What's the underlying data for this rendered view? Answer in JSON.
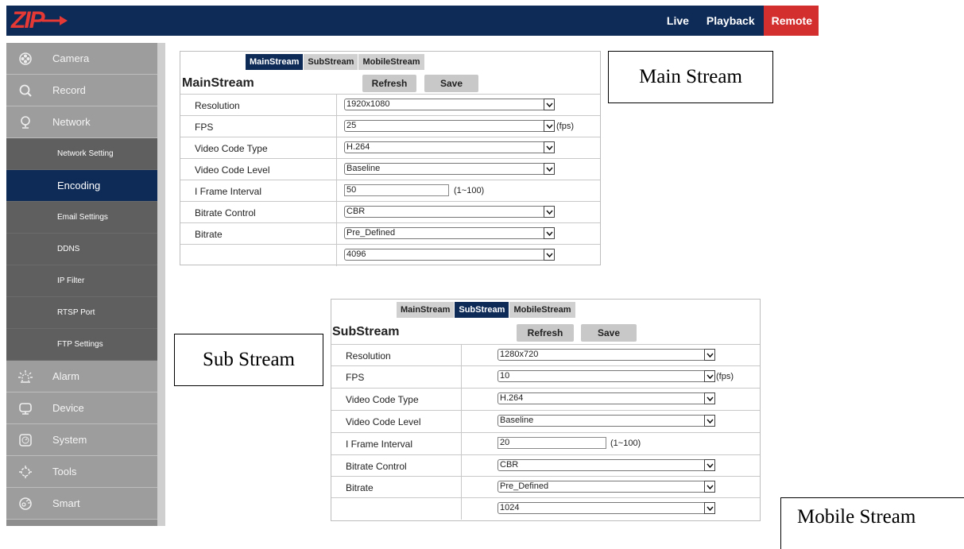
{
  "header": {
    "logo_text": "ZIP",
    "nav": [
      "Live",
      "Playback",
      "Remote"
    ]
  },
  "sidebar": {
    "items": [
      {
        "label": "Camera",
        "icon": "camera-icon"
      },
      {
        "label": "Record",
        "icon": "search-icon"
      },
      {
        "label": "Network",
        "icon": "network-icon"
      }
    ],
    "network_sub": [
      {
        "label": "Network Setting"
      },
      {
        "label": "Encoding"
      },
      {
        "label": "Email Settings"
      },
      {
        "label": "DDNS"
      },
      {
        "label": "IP Filter"
      },
      {
        "label": "RTSP Port"
      },
      {
        "label": "FTP Settings"
      }
    ],
    "items_after": [
      {
        "label": "Alarm",
        "icon": "alarm-icon"
      },
      {
        "label": "Device",
        "icon": "device-icon"
      },
      {
        "label": "System",
        "icon": "system-icon"
      },
      {
        "label": "Tools",
        "icon": "gear-icon"
      },
      {
        "label": "Smart",
        "icon": "smart-icon"
      }
    ]
  },
  "colors": {
    "header_bg": "#0e2b57",
    "active_nav": "#d32f2f",
    "active_tab": "#0e2b57"
  },
  "tabs": [
    "MainStream",
    "SubStream",
    "MobileStream"
  ],
  "buttons": {
    "refresh": "Refresh",
    "save": "Save"
  },
  "main_panel": {
    "title": "MainStream",
    "rows": [
      {
        "label": "Resolution",
        "value": "1920x1080"
      },
      {
        "label": "FPS",
        "value": "25",
        "suffix": "(fps)"
      },
      {
        "label": "Video Code Type",
        "value": "H.264"
      },
      {
        "label": "Video Code Level",
        "value": "Baseline"
      },
      {
        "label": "I Frame Interval",
        "value": "50",
        "suffix": "(1~100)"
      },
      {
        "label": "Bitrate Control",
        "value": "CBR"
      },
      {
        "label": "Bitrate",
        "value": "Pre_Defined"
      },
      {
        "label": "",
        "value": "4096"
      }
    ]
  },
  "sub_panel": {
    "title": "SubStream",
    "rows": [
      {
        "label": "Resolution",
        "value": "1280x720"
      },
      {
        "label": "FPS",
        "value": "10",
        "suffix": "(fps)"
      },
      {
        "label": "Video Code Type",
        "value": "H.264"
      },
      {
        "label": "Video Code Level",
        "value": "Baseline"
      },
      {
        "label": "I Frame Interval",
        "value": "20",
        "suffix": "(1~100)"
      },
      {
        "label": "Bitrate Control",
        "value": "CBR"
      },
      {
        "label": "Bitrate",
        "value": "Pre_Defined"
      },
      {
        "label": "",
        "value": "1024"
      }
    ]
  },
  "callouts": {
    "main": "Main Stream",
    "sub": "Sub Stream",
    "mobile": "Mobile Stream"
  }
}
